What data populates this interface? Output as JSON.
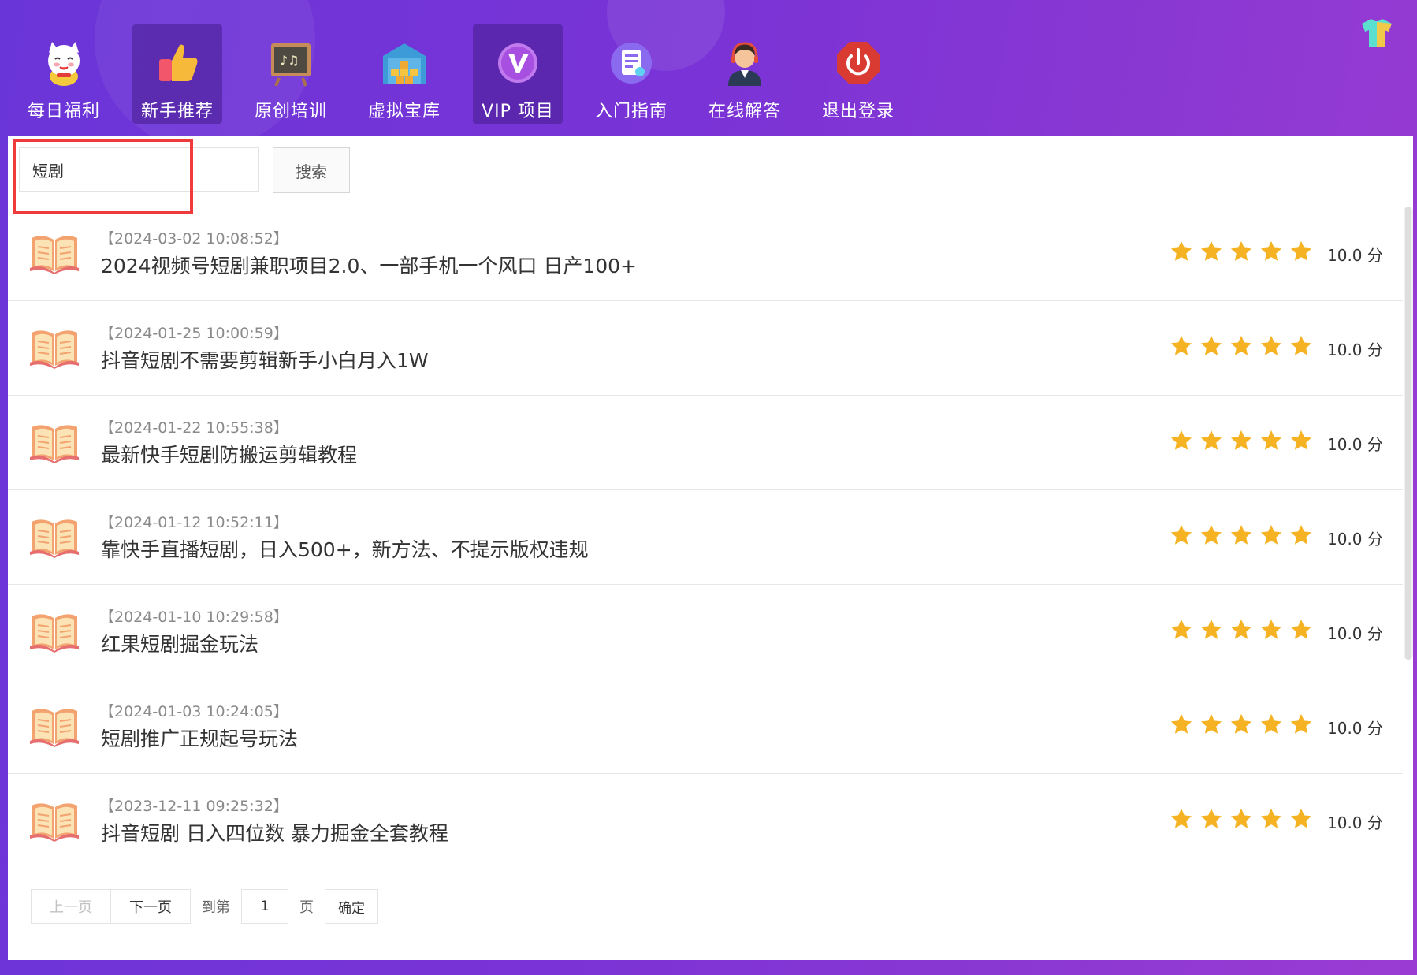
{
  "nav": [
    {
      "label": "每日福利",
      "icon": "lucky-cat-icon",
      "active": false
    },
    {
      "label": "新手推荐",
      "icon": "thumbs-up-icon",
      "active": true
    },
    {
      "label": "原创培训",
      "icon": "blackboard-icon",
      "active": false
    },
    {
      "label": "虚拟宝库",
      "icon": "warehouse-icon",
      "active": false
    },
    {
      "label": "VIP 项目",
      "icon": "vip-badge-icon",
      "active": true
    },
    {
      "label": "入门指南",
      "icon": "guide-document-icon",
      "active": false
    },
    {
      "label": "在线解答",
      "icon": "support-agent-icon",
      "active": false
    },
    {
      "label": "退出登录",
      "icon": "power-icon",
      "active": false
    }
  ],
  "search": {
    "value": "短剧",
    "button_label": "搜索"
  },
  "items": [
    {
      "date": "【2024-03-02 10:08:52】",
      "title": "2024视频号短剧兼职项目2.0、一部手机一个风口 日产100+",
      "rating": 5,
      "score": "10.0 分"
    },
    {
      "date": "【2024-01-25 10:00:59】",
      "title": "抖音短剧不需要剪辑新手小白月入1W",
      "rating": 5,
      "score": "10.0 分"
    },
    {
      "date": "【2024-01-22 10:55:38】",
      "title": "最新快手短剧防搬运剪辑教程",
      "rating": 5,
      "score": "10.0 分"
    },
    {
      "date": "【2024-01-12 10:52:11】",
      "title": "靠快手直播短剧，日入500+，新方法、不提示版权违规",
      "rating": 5,
      "score": "10.0 分"
    },
    {
      "date": "【2024-01-10 10:29:58】",
      "title": "红果短剧掘金玩法",
      "rating": 5,
      "score": "10.0 分"
    },
    {
      "date": "【2024-01-03 10:24:05】",
      "title": "短剧推广正规起号玩法",
      "rating": 5,
      "score": "10.0 分"
    },
    {
      "date": "【2023-12-11 09:25:32】",
      "title": "抖音短剧 日入四位数 暴力掘金全套教程",
      "rating": 5,
      "score": "10.0 分"
    }
  ],
  "pager": {
    "prev": "上一页",
    "next": "下一页",
    "goto_prefix": "到第",
    "page": "1",
    "goto_suffix": "页",
    "confirm": "确定"
  },
  "colors": {
    "header_start": "#6a35d8",
    "header_end": "#9a3cd4",
    "star": "#f5b324",
    "highlight": "#ef3b3b"
  }
}
